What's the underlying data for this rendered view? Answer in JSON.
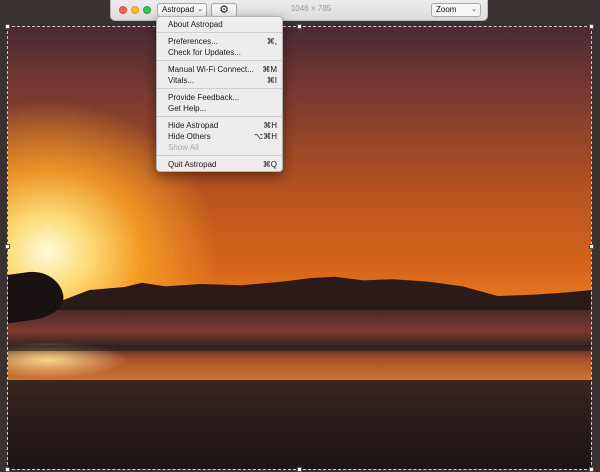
{
  "toolbar": {
    "app_name": "Astropad",
    "resolution": "1046 × 785",
    "zoom_label": "Zoom"
  },
  "icons": {
    "close": "close-traffic-light",
    "minimize": "minimize-traffic-light",
    "zoom": "zoom-traffic-light",
    "gear": "gear-icon",
    "chevron": "chevron-down-icon"
  },
  "menu": {
    "about": "About Astropad",
    "preferences": "Preferences...",
    "preferences_shortcut": "⌘,",
    "check_updates": "Check for Updates...",
    "manual_wifi": "Manual Wi-Fi Connect...",
    "manual_wifi_shortcut": "⌘M",
    "vitals": "Vitals...",
    "vitals_shortcut": "⌘I",
    "feedback": "Provide Feedback...",
    "help": "Get Help...",
    "hide": "Hide Astropad",
    "hide_shortcut": "⌘H",
    "hide_others": "Hide Others",
    "hide_others_shortcut": "⌥⌘H",
    "show_all": "Show All",
    "quit": "Quit Astropad",
    "quit_shortcut": "⌘Q"
  },
  "colors": {
    "accent_red": "#fc5f57",
    "accent_yellow": "#fdbc2e",
    "accent_green": "#34c84a"
  }
}
